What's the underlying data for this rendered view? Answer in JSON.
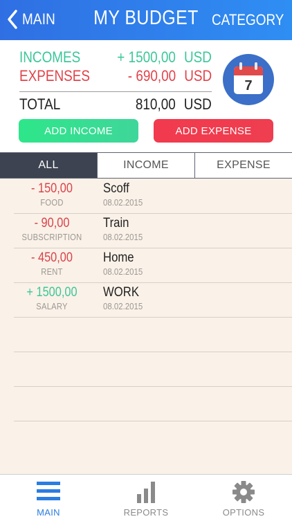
{
  "header": {
    "back_label": "MAIN",
    "title": "MY BUDGET",
    "right_label": "CATEGORY"
  },
  "summary": {
    "incomes_label": "INCOMES",
    "incomes_value": "+ 1500,00",
    "expenses_label": "EXPENSES",
    "expenses_value": "- 690,00",
    "total_label": "TOTAL",
    "total_value": "810,00",
    "currency": "USD",
    "calendar_day": "7"
  },
  "actions": {
    "add_income": "ADD INCOME",
    "add_expense": "ADD EXPENSE"
  },
  "filter_tabs": [
    "ALL",
    "INCOME",
    "EXPENSE"
  ],
  "entries": [
    {
      "amount": "- 150,00",
      "category": "FOOD",
      "name": "Scoff",
      "date": "08.02.2015",
      "type": "expense"
    },
    {
      "amount": "- 90,00",
      "category": "SUBSCRIPTION",
      "name": "Train",
      "date": "08.02.2015",
      "type": "expense"
    },
    {
      "amount": "- 450,00",
      "category": "RENT",
      "name": "Home",
      "date": "08.02.2015",
      "type": "expense"
    },
    {
      "amount": "+ 1500,00",
      "category": "SALARY",
      "name": "WORK",
      "date": "08.02.2015",
      "type": "income"
    }
  ],
  "tabbar": {
    "main": "MAIN",
    "reports": "REPORTS",
    "options": "OPTIONS"
  },
  "icons": {
    "back": "chevron-left-icon",
    "calendar": "calendar-icon",
    "main": "menu-icon",
    "reports": "bar-chart-icon",
    "options": "gear-icon"
  },
  "colors": {
    "header_blue": "#2f7fe9",
    "income_green": "#3cc79a",
    "expense_red": "#e0434a",
    "tab_active": "#3d4350",
    "list_bg": "#faf1e8",
    "tabbar_active": "#2a7de1"
  }
}
